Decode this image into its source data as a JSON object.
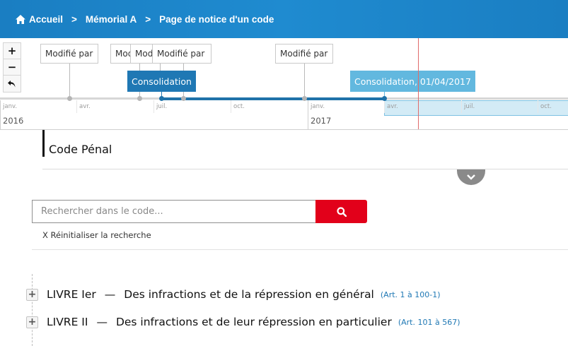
{
  "breadcrumb": {
    "items": [
      "Accueil",
      "Mémorial A",
      "Page de notice d'un code"
    ],
    "separator": ">"
  },
  "timeline": {
    "zoom_in": "+",
    "zoom_out": "−",
    "reset": "↶",
    "events": [
      {
        "label": "Modifié par",
        "date": "2016-03-01"
      },
      {
        "label": "Modifié par",
        "date": "2016-06-01"
      },
      {
        "label": "Modifié par",
        "date": "2016-06-20"
      },
      {
        "label": "Modifié par",
        "date": "2016-07-15"
      },
      {
        "label": "Modifié par",
        "date": "2016-12-31"
      }
    ],
    "consolidations": [
      {
        "label": "Consolidation",
        "date": "2016-07-01",
        "style": "dark"
      },
      {
        "label": "Consolidation, 01/04/2017",
        "date": "2017-04-01",
        "style": "light"
      }
    ],
    "months": [
      "janv.",
      "avr.",
      "juil.",
      "oct.",
      "janv.",
      "avr.",
      "juil.",
      "oct."
    ],
    "years": [
      "2016",
      "2017"
    ],
    "colors": {
      "active": "#1f72a9",
      "consolidation_dark": "#1f78b4",
      "consolidation_light": "#62b8df",
      "now_line": "#e06b6b"
    }
  },
  "code": {
    "title": "Code Pénal",
    "toggle_icon": "chevron-down-icon"
  },
  "search": {
    "placeholder": "Rechercher dans le code...",
    "value": "",
    "button_icon": "search-icon",
    "reset_label": "X Réinitialiser la recherche",
    "button_color": "#e2001a"
  },
  "tree": {
    "items": [
      {
        "toggle": "+",
        "number": "LIVRE Ier",
        "dash": "—",
        "title": "Des infractions et de la répression en général",
        "range": "(Art. 1 à 100-1)"
      },
      {
        "toggle": "+",
        "number": "LIVRE II",
        "dash": "—",
        "title": "Des infractions et de leur répression en particulier",
        "range": "(Art. 101 à 567)"
      }
    ]
  }
}
